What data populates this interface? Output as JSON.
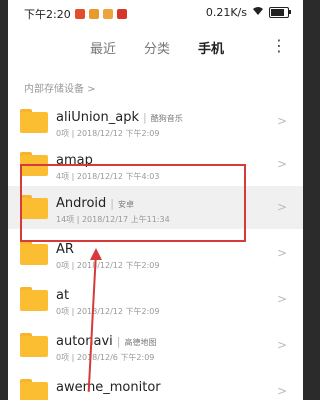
{
  "status": {
    "time": "下午2:20",
    "network": "0.21K/s",
    "colors": {
      "app1": "#e34b2c",
      "app2": "#e89b2c",
      "app3": "#f0a33a",
      "app4": "#d8352a"
    }
  },
  "tabs": [
    {
      "label": "最近"
    },
    {
      "label": "分类"
    },
    {
      "label": "手机"
    }
  ],
  "menu_icon": "more-vertical-icon",
  "breadcrumb": "内部存储设备 >",
  "files": [
    {
      "name": "aliUnion_apk",
      "alias": "酷狗音乐",
      "meta": "0项  |  2018/12/12 下午2:09"
    },
    {
      "name": "amap",
      "alias": "",
      "meta": "4项  |  2018/12/12 下午4:03"
    },
    {
      "name": "Android",
      "alias": "安卓",
      "meta": "14项  |  2018/12/17 上午11:34"
    },
    {
      "name": "AR",
      "alias": "",
      "meta": "0项  |  2018/12/12 下午2:09"
    },
    {
      "name": "at",
      "alias": "",
      "meta": "0项  |  2018/12/12 下午2:09"
    },
    {
      "name": "autonavi",
      "alias": "高德地图",
      "meta": "0项  |  2018/12/6 下午2:09"
    },
    {
      "name": "aweme_monitor",
      "alias": "",
      "meta": ""
    }
  ]
}
